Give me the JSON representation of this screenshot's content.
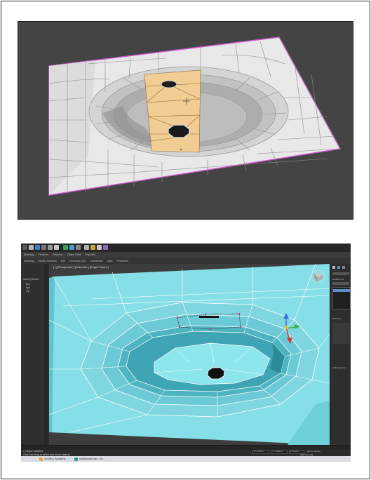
{
  "top_figure": {
    "description_colors": {
      "background": "#444444",
      "plane_fill": "#e6e6e6",
      "plane_border": "#d35ad3",
      "selection": "#f2cd93",
      "wire": "#8c8c8c"
    },
    "icons": [
      "cursor-crosshair-icon"
    ]
  },
  "max_ui": {
    "ribbon_tabs": [
      "Modeling",
      "Freeform",
      "Selection",
      "Object Paint",
      "Populate"
    ],
    "ribbon_items": [
      "Modeling",
      "Modify Selection",
      "Edit",
      "Geometry (All)",
      "Subdivision",
      "Align",
      "Properties"
    ],
    "viewport_label": "[+] [Perspective ] [Standard ] [Edged Faces ]",
    "scene_explorer_rows": [
      "Name (Sorted",
      "Box",
      "Sph",
      "Cyl"
    ],
    "command_panel_rows": [
      "Modifier List",
      "Selection",
      "Soft Selection"
    ],
    "status": {
      "selection": "1 Object Selected",
      "prompt": "Click and drag to select and move objects",
      "x_value": "X: 0.112m",
      "y_value": "Y: -0.00cm",
      "z_value": "Z: 0.0cm",
      "grid": "Grid = 10.0cm",
      "add_time_tag": "Add Time Tag"
    },
    "taskbar": {
      "items": [
        "3D2ON | Parabene ...",
        "selectionab.max - Re..."
      ]
    },
    "colors": {
      "viewport_bg": "#3d3d3d",
      "mesh": "#7fdde6",
      "mesh_dark": "#4fb4c2",
      "edge": "#ffffff",
      "ui_dark": "#2b2b2b",
      "selected_list": "#5b8fc7"
    }
  }
}
